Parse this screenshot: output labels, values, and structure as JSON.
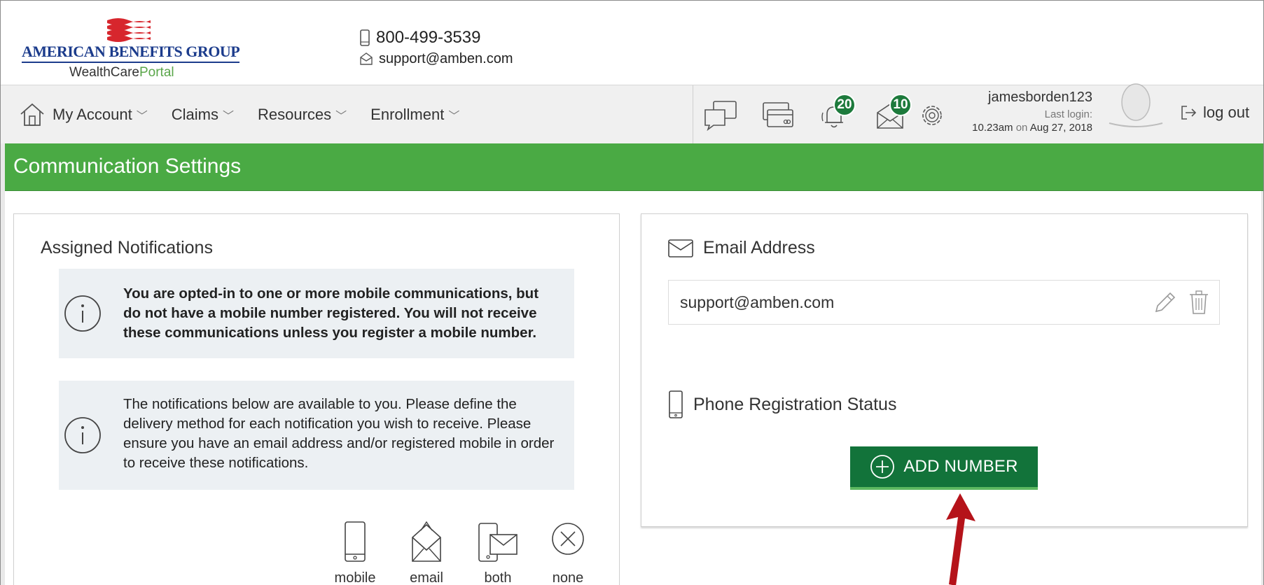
{
  "header": {
    "logo_brand": "AMERICAN BENEFITS GROUP",
    "logo_sub_main": "WealthCare",
    "logo_sub_accent": "Portal",
    "phone": "800-499-3539",
    "email": "support@amben.com"
  },
  "nav": {
    "items": [
      {
        "label": "My Account"
      },
      {
        "label": "Claims"
      },
      {
        "label": "Resources"
      },
      {
        "label": "Enrollment"
      }
    ],
    "notifications_count": "20",
    "messages_count": "10",
    "username": "jamesborden123",
    "last_login_label": "Last login:",
    "last_login_time": "10.23am",
    "last_login_on": "on",
    "last_login_date": "Aug 27, 2018",
    "logout_label": "log out"
  },
  "page": {
    "title": "Communication Settings"
  },
  "assigned": {
    "heading": "Assigned Notifications",
    "warning": "You are opted-in to one or more mobile communications, but do not have a mobile number registered. You will not receive these communications unless you register a mobile number.",
    "info": "The notifications below are available to you. Please define the delivery method for each notification you wish to receive. Please ensure you have an email address and/or registered mobile in order to receive these notifications.",
    "methods": [
      {
        "label": "mobile",
        "icon": "mobile-icon"
      },
      {
        "label": "email",
        "icon": "envelope-open-icon"
      },
      {
        "label": "both",
        "icon": "mobile-email-icon"
      },
      {
        "label": "none",
        "icon": "x-circle-icon"
      }
    ]
  },
  "contact_settings": {
    "email_heading": "Email Address",
    "email_value": "support@amben.com",
    "phone_heading": "Phone Registration Status",
    "add_number_label": "ADD NUMBER"
  },
  "colors": {
    "green_bar": "#4aaa44",
    "button_green": "#12733a",
    "badge_green": "#1d7a3c",
    "logo_blue": "#1c3c8c",
    "arrow_red": "#b5131a"
  }
}
